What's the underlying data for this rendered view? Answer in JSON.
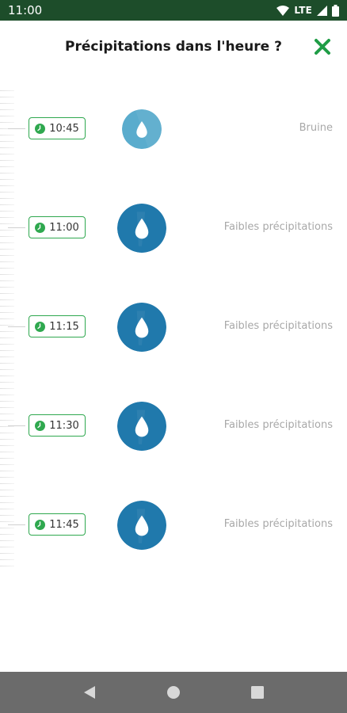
{
  "status_bar": {
    "time": "11:00",
    "network": "LTE"
  },
  "header": {
    "title": "Précipitations dans l'heure ?"
  },
  "forecast": [
    {
      "time": "10:45",
      "label": "Bruine",
      "intensity": "drizzle",
      "color": "#5aaccd"
    },
    {
      "time": "11:00",
      "label": "Faibles précipitations",
      "intensity": "light",
      "color": "#2079ac"
    },
    {
      "time": "11:15",
      "label": "Faibles précipitations",
      "intensity": "light",
      "color": "#2079ac"
    },
    {
      "time": "11:30",
      "label": "Faibles précipitations",
      "intensity": "light",
      "color": "#2079ac"
    },
    {
      "time": "11:45",
      "label": "Faibles précipitations",
      "intensity": "light",
      "color": "#2079ac"
    }
  ],
  "colors": {
    "status_bar_bg": "#1d4d2a",
    "accent_green": "#2fa84f",
    "close_icon": "#1f9d46",
    "nav_bar_bg": "#6b6b6b"
  },
  "icons": {
    "status": [
      "wifi-icon",
      "signal-icon",
      "battery-icon"
    ],
    "close": "close-icon",
    "clock": "clock-icon",
    "drop": "rain-drop-icon",
    "nav": [
      "back-icon",
      "home-icon",
      "recents-icon"
    ]
  }
}
